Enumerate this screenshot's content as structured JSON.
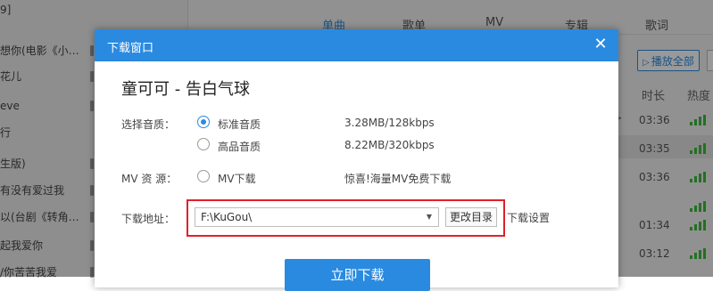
{
  "background": {
    "left_list": [
      {
        "text": "9]",
        "marker": false
      },
      {
        "text": "想你(电影《小…",
        "marker": true
      },
      {
        "text": "花儿",
        "marker": true
      },
      {
        "text": "eve",
        "marker": true
      },
      {
        "text": "行",
        "marker": false
      },
      {
        "text": "生版)",
        "marker": true
      },
      {
        "text": "有没有爱过我",
        "marker": true
      },
      {
        "text": "以(台剧《转角…",
        "marker": true
      },
      {
        "text": "起我爱你",
        "marker": true
      },
      {
        "text": "/你苦苦我爱",
        "marker": true
      }
    ],
    "tabs": [
      "单曲",
      "歌单",
      "MV",
      "专辑",
      "歌词"
    ],
    "active_tab": "单曲",
    "play_all_label": "播放全部",
    "col_duration": "时长",
    "col_hot": "热度",
    "durations": [
      "03:36",
      "03:35",
      "03:36",
      "01:34",
      "03:12"
    ]
  },
  "dialog": {
    "title": "下载窗口",
    "song": "童可可 - 告白气球",
    "quality_label": "选择音质：",
    "quality_options": [
      {
        "label": "标准音质",
        "size": "3.28MB/128kbps",
        "checked": true
      },
      {
        "label": "高品音质",
        "size": "8.22MB/320kbps",
        "checked": false
      }
    ],
    "mv_label": "MV 资 源：",
    "mv_option": "MV下载",
    "mv_promo": "惊喜!海量MV免费下载",
    "path_label": "下载地址：",
    "path_value": "F:\\KuGou\\",
    "change_dir_label": "更改目录",
    "settings_label": "下载设置",
    "download_label": "立即下载",
    "accent_color": "#2a8ae0",
    "highlight_color": "#e0202a"
  }
}
